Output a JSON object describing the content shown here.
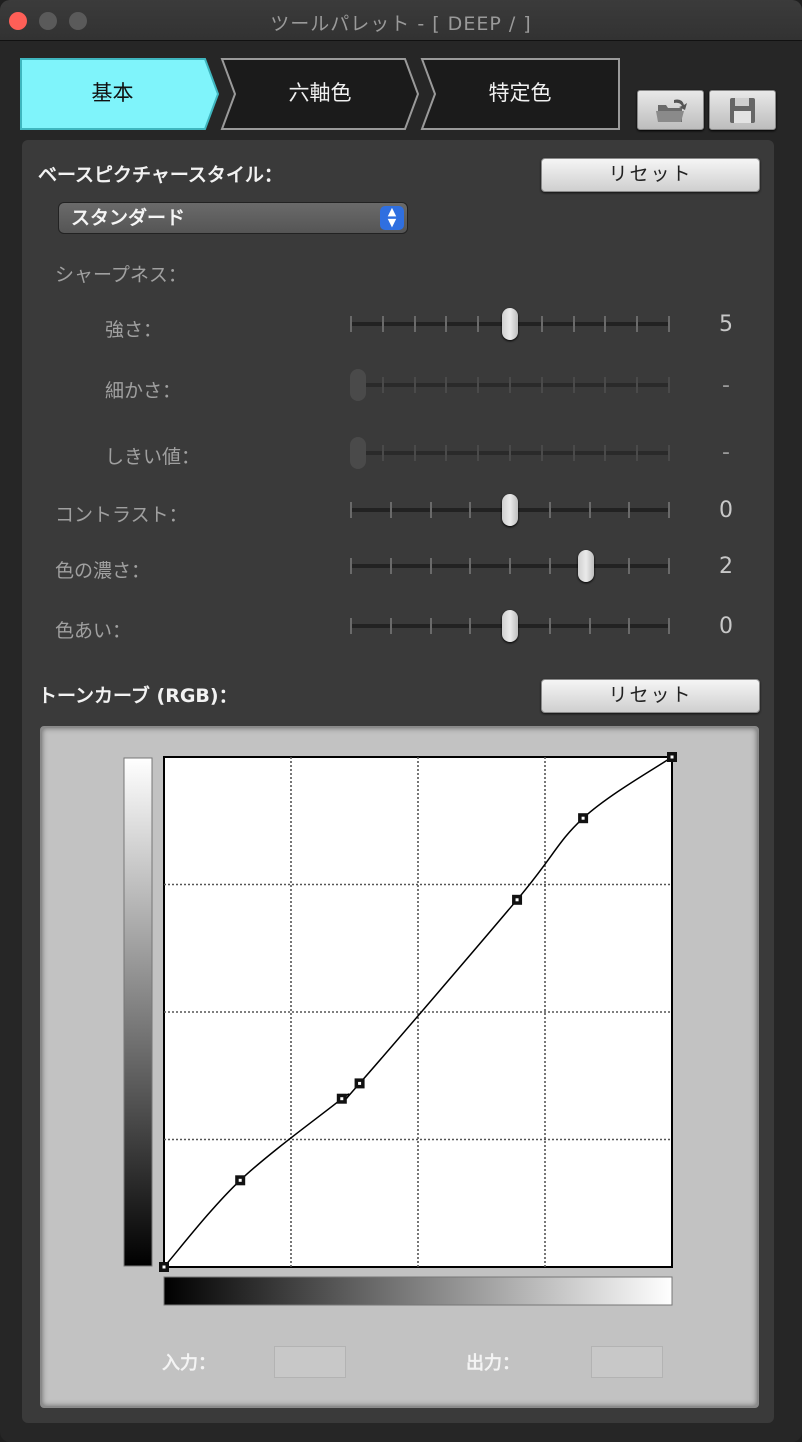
{
  "window": {
    "title": "ツールパレット - [ DEEP /  ]"
  },
  "tabs": [
    {
      "label": "基本",
      "active": true
    },
    {
      "label": "六軸色",
      "active": false
    },
    {
      "label": "特定色",
      "active": false
    }
  ],
  "toolbar": {
    "open_icon": "folder-open-icon",
    "save_icon": "floppy-save-icon"
  },
  "base_style": {
    "label": "ベースピクチャースタイル：",
    "reset_label": "リセット",
    "selected": "スタンダード"
  },
  "sharpness": {
    "label": "シャープネス：",
    "strength": {
      "label": "強さ：",
      "value": "5",
      "position": 0.5,
      "enabled": true
    },
    "fineness": {
      "label": "細かさ：",
      "value": "-",
      "position": 0,
      "enabled": false
    },
    "threshold": {
      "label": "しきい値：",
      "value": "-",
      "position": 0,
      "enabled": false
    }
  },
  "contrast": {
    "label": "コントラスト：",
    "value": "0",
    "position": 0.5
  },
  "saturation": {
    "label": "色の濃さ：",
    "value": "2",
    "position": 0.75
  },
  "hue": {
    "label": "色あい：",
    "value": "0",
    "position": 0.5
  },
  "tone_curve": {
    "label": "トーンカーブ (RGB)：",
    "reset_label": "リセット",
    "input_label": "入力：",
    "output_label": "出力：",
    "points": [
      [
        0,
        0
      ],
      [
        0.15,
        0.17
      ],
      [
        0.35,
        0.33
      ],
      [
        0.385,
        0.36
      ],
      [
        0.695,
        0.72
      ],
      [
        0.825,
        0.88
      ],
      [
        1,
        1
      ]
    ]
  },
  "colors": {
    "active_tab": "#7ff4fb",
    "accent_blue": "#2f6fe0",
    "close_red": "#fe5f57"
  }
}
